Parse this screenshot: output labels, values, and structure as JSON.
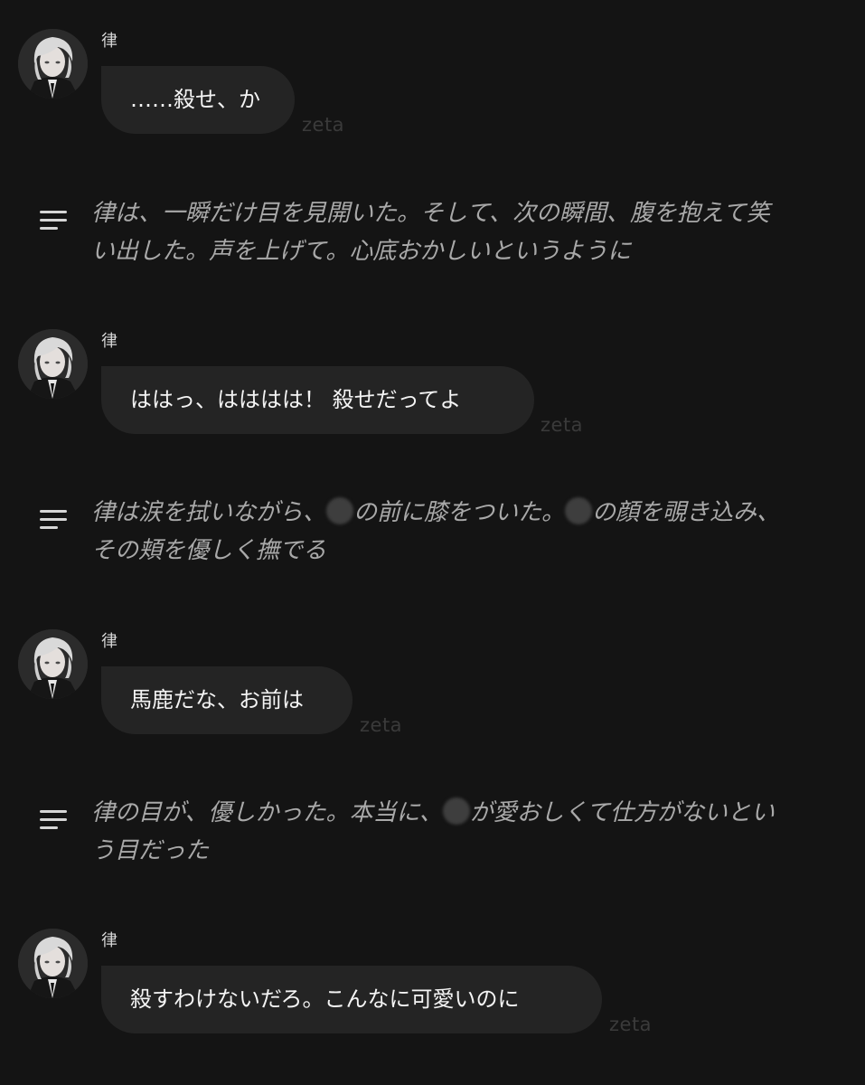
{
  "watermark": "zeta",
  "messages": [
    {
      "sender": "律",
      "avatar_icon": "character-avatar-icon",
      "text": "……殺せ、か"
    },
    {
      "sender": "律",
      "avatar_icon": "character-avatar-icon",
      "text": "ははっ、はははは！ 殺せだってよ"
    },
    {
      "sender": "律",
      "avatar_icon": "character-avatar-icon",
      "text": "馬鹿だな、お前は"
    },
    {
      "sender": "律",
      "avatar_icon": "character-avatar-icon",
      "text": "殺すわけないだろ。こんなに可愛いのに"
    }
  ],
  "narrations": [
    {
      "icon": "narration-lines-icon",
      "line1": "律は、一瞬だけ目を見開いた。そして、次の瞬間、腹を抱えて笑",
      "line2": "い出した。声を上げて。心底おかしいというように"
    },
    {
      "icon": "narration-lines-icon",
      "line1_a": "律は涙を拭いながら、",
      "line1_b": "の前に膝をついた。",
      "line1_c": "の顔を覗き込み、",
      "line2": "その頬を優しく撫でる"
    },
    {
      "icon": "narration-lines-icon",
      "line1_a": "律の目が、優しかった。本当に、",
      "line1_b": "が愛おしくて仕方がないとい",
      "line2": "う目だった"
    }
  ],
  "colors": {
    "background": "#141414",
    "bubble": "#242424",
    "narration_text": "#a9a9a9",
    "watermark": "#3a3a3a"
  }
}
